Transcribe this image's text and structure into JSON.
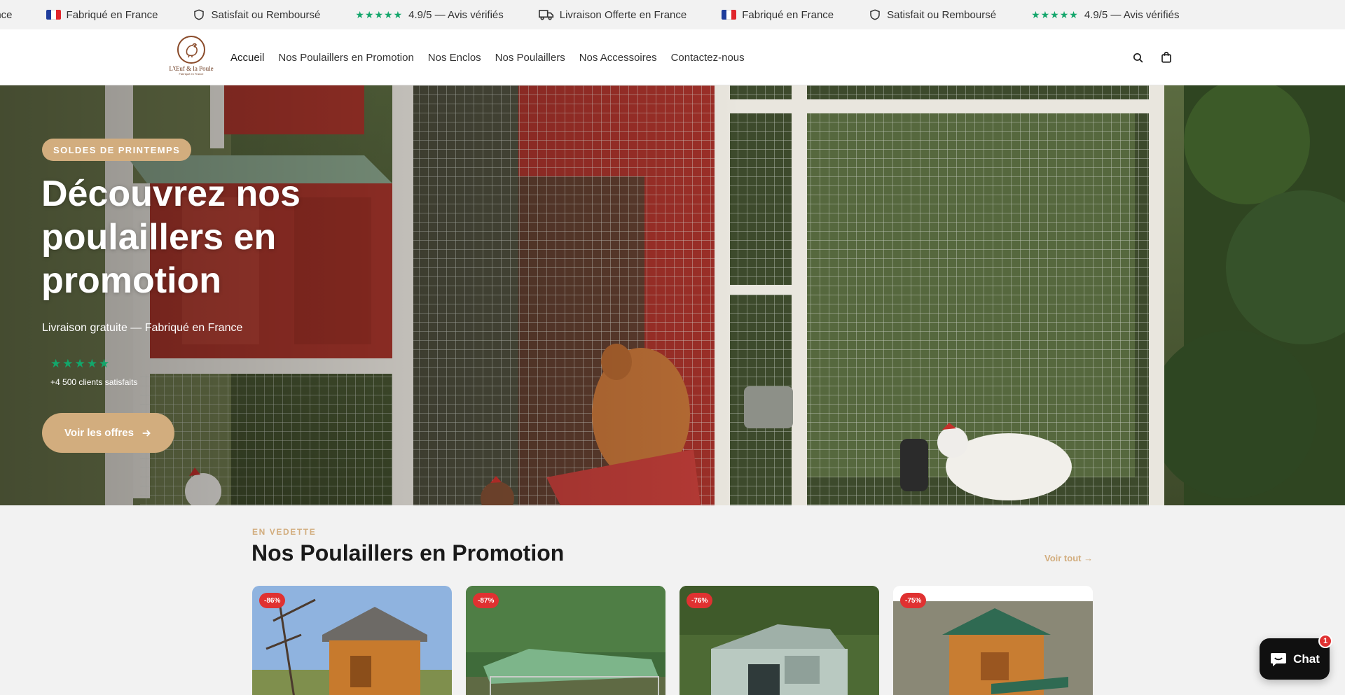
{
  "announcements": [
    {
      "icon": "flag-fr-icon",
      "text": "rance"
    },
    {
      "icon": "flag-fr-icon",
      "text": "Fabriqué en France"
    },
    {
      "icon": "shield-icon",
      "text": "Satisfait ou Remboursé"
    },
    {
      "icon": "stars-icon",
      "text": "4.9/5 — Avis vérifiés"
    },
    {
      "icon": "truck-icon",
      "text": "Livraison Offerte en France"
    },
    {
      "icon": "flag-fr-icon",
      "text": "Fabriqué en France"
    },
    {
      "icon": "shield-icon",
      "text": "Satisfait ou Remboursé"
    },
    {
      "icon": "stars-icon",
      "text": "4.9/5 — Avis vérifiés"
    }
  ],
  "announcement_stars": "★★★★★",
  "brand": {
    "name": "L'Œuf & la Poule",
    "tagline": "Fabriqué en France"
  },
  "nav": {
    "items": [
      "Accueil",
      "Nos Poulaillers en Promotion",
      "Nos Enclos",
      "Nos Poulaillers",
      "Nos Accessoires",
      "Contactez-nous"
    ],
    "active": "Accueil"
  },
  "hero": {
    "badge": "SOLDES DE PRINTEMPS",
    "title": "Découvrez nos poulaillers en promotion",
    "subtitle": "Livraison gratuite — Fabriqué en France",
    "stars": "★★★★★",
    "clients": "+4 500 clients satisfaits",
    "cta": "Voir les offres"
  },
  "featured": {
    "eyebrow": "EN VEDETTE",
    "title": "Nos Poulaillers en Promotion",
    "view_all": "Voir tout →",
    "products": [
      {
        "discount": "-86%"
      },
      {
        "discount": "-87%"
      },
      {
        "discount": "-76%"
      },
      {
        "discount": "-75%"
      }
    ]
  },
  "chat": {
    "label": "Chat",
    "count": "1"
  },
  "colors": {
    "accent": "#d2ad7e",
    "star_green": "#13a66b",
    "sale_red": "#e03131",
    "chat_bg": "#101010"
  }
}
